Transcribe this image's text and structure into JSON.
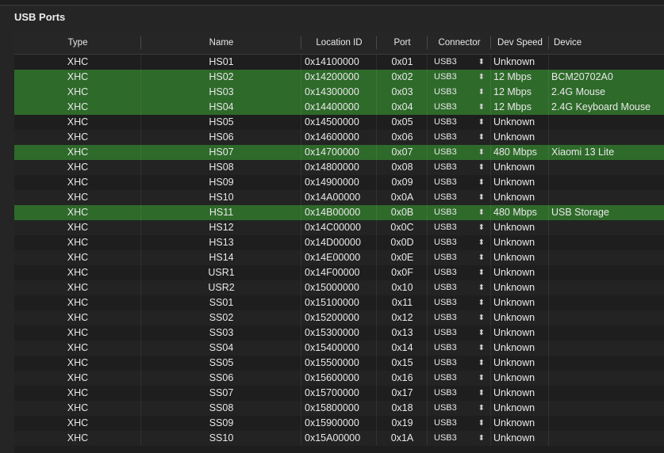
{
  "panel": {
    "title": "USB Ports"
  },
  "columns": [
    "Type",
    "Name",
    "Location ID",
    "Port",
    "Connector",
    "Dev Speed",
    "Device"
  ],
  "connector_arrow": "⌃⌄",
  "rows": [
    {
      "type": "XHC",
      "name": "HS01",
      "location": "0x14100000",
      "port": "0x01",
      "connector": "USB3",
      "speed": "Unknown",
      "device": "",
      "selected": false
    },
    {
      "type": "XHC",
      "name": "HS02",
      "location": "0x14200000",
      "port": "0x02",
      "connector": "USB3",
      "speed": "12 Mbps",
      "device": "BCM20702A0",
      "selected": true
    },
    {
      "type": "XHC",
      "name": "HS03",
      "location": "0x14300000",
      "port": "0x03",
      "connector": "USB3",
      "speed": "12 Mbps",
      "device": "2.4G Mouse",
      "selected": true
    },
    {
      "type": "XHC",
      "name": "HS04",
      "location": "0x14400000",
      "port": "0x04",
      "connector": "USB3",
      "speed": "12 Mbps",
      "device": "2.4G Keyboard Mouse",
      "selected": true
    },
    {
      "type": "XHC",
      "name": "HS05",
      "location": "0x14500000",
      "port": "0x05",
      "connector": "USB3",
      "speed": "Unknown",
      "device": "",
      "selected": false
    },
    {
      "type": "XHC",
      "name": "HS06",
      "location": "0x14600000",
      "port": "0x06",
      "connector": "USB3",
      "speed": "Unknown",
      "device": "",
      "selected": false
    },
    {
      "type": "XHC",
      "name": "HS07",
      "location": "0x14700000",
      "port": "0x07",
      "connector": "USB3",
      "speed": "480 Mbps",
      "device": "Xiaomi 13 Lite",
      "selected": true
    },
    {
      "type": "XHC",
      "name": "HS08",
      "location": "0x14800000",
      "port": "0x08",
      "connector": "USB3",
      "speed": "Unknown",
      "device": "",
      "selected": false
    },
    {
      "type": "XHC",
      "name": "HS09",
      "location": "0x14900000",
      "port": "0x09",
      "connector": "USB3",
      "speed": "Unknown",
      "device": "",
      "selected": false
    },
    {
      "type": "XHC",
      "name": "HS10",
      "location": "0x14A00000",
      "port": "0x0A",
      "connector": "USB3",
      "speed": "Unknown",
      "device": "",
      "selected": false
    },
    {
      "type": "XHC",
      "name": "HS11",
      "location": "0x14B00000",
      "port": "0x0B",
      "connector": "USB3",
      "speed": "480 Mbps",
      "device": "USB Storage",
      "selected": true
    },
    {
      "type": "XHC",
      "name": "HS12",
      "location": "0x14C00000",
      "port": "0x0C",
      "connector": "USB3",
      "speed": "Unknown",
      "device": "",
      "selected": false
    },
    {
      "type": "XHC",
      "name": "HS13",
      "location": "0x14D00000",
      "port": "0x0D",
      "connector": "USB3",
      "speed": "Unknown",
      "device": "",
      "selected": false
    },
    {
      "type": "XHC",
      "name": "HS14",
      "location": "0x14E00000",
      "port": "0x0E",
      "connector": "USB3",
      "speed": "Unknown",
      "device": "",
      "selected": false
    },
    {
      "type": "XHC",
      "name": "USR1",
      "location": "0x14F00000",
      "port": "0x0F",
      "connector": "USB3",
      "speed": "Unknown",
      "device": "",
      "selected": false
    },
    {
      "type": "XHC",
      "name": "USR2",
      "location": "0x15000000",
      "port": "0x10",
      "connector": "USB3",
      "speed": "Unknown",
      "device": "",
      "selected": false
    },
    {
      "type": "XHC",
      "name": "SS01",
      "location": "0x15100000",
      "port": "0x11",
      "connector": "USB3",
      "speed": "Unknown",
      "device": "",
      "selected": false
    },
    {
      "type": "XHC",
      "name": "SS02",
      "location": "0x15200000",
      "port": "0x12",
      "connector": "USB3",
      "speed": "Unknown",
      "device": "",
      "selected": false
    },
    {
      "type": "XHC",
      "name": "SS03",
      "location": "0x15300000",
      "port": "0x13",
      "connector": "USB3",
      "speed": "Unknown",
      "device": "",
      "selected": false
    },
    {
      "type": "XHC",
      "name": "SS04",
      "location": "0x15400000",
      "port": "0x14",
      "connector": "USB3",
      "speed": "Unknown",
      "device": "",
      "selected": false
    },
    {
      "type": "XHC",
      "name": "SS05",
      "location": "0x15500000",
      "port": "0x15",
      "connector": "USB3",
      "speed": "Unknown",
      "device": "",
      "selected": false
    },
    {
      "type": "XHC",
      "name": "SS06",
      "location": "0x15600000",
      "port": "0x16",
      "connector": "USB3",
      "speed": "Unknown",
      "device": "",
      "selected": false
    },
    {
      "type": "XHC",
      "name": "SS07",
      "location": "0x15700000",
      "port": "0x17",
      "connector": "USB3",
      "speed": "Unknown",
      "device": "",
      "selected": false
    },
    {
      "type": "XHC",
      "name": "SS08",
      "location": "0x15800000",
      "port": "0x18",
      "connector": "USB3",
      "speed": "Unknown",
      "device": "",
      "selected": false
    },
    {
      "type": "XHC",
      "name": "SS09",
      "location": "0x15900000",
      "port": "0x19",
      "connector": "USB3",
      "speed": "Unknown",
      "device": "",
      "selected": false
    },
    {
      "type": "XHC",
      "name": "SS10",
      "location": "0x15A00000",
      "port": "0x1A",
      "connector": "USB3",
      "speed": "Unknown",
      "device": "",
      "selected": false
    }
  ],
  "colors": {
    "selected_row": "#2e6a2a",
    "background": "#1e1e1e"
  }
}
